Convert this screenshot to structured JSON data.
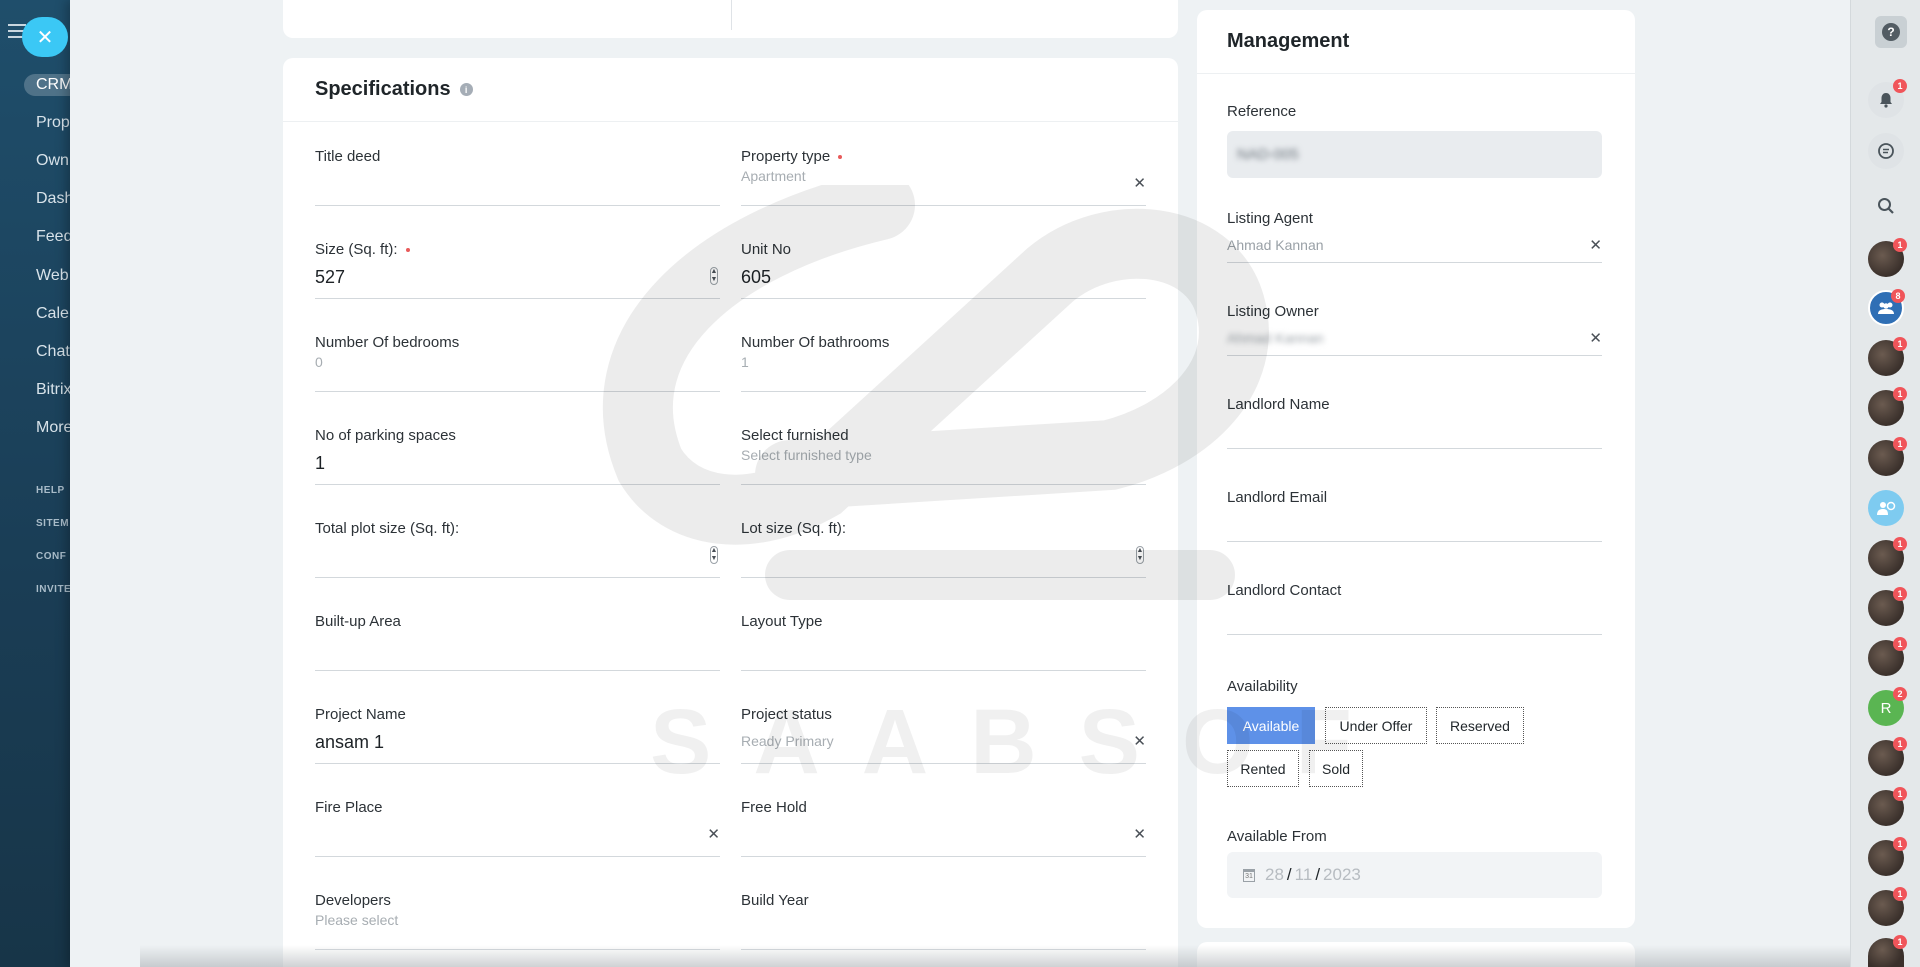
{
  "nav": {
    "items": [
      "CRM",
      "Prop",
      "Own",
      "Dash",
      "Feed",
      "Web",
      "Cale",
      "Chat",
      "Bitrix",
      "More"
    ],
    "small_items": [
      "HELP",
      "SITEM",
      "CONF",
      "INVITE"
    ]
  },
  "specifications": {
    "title": "Specifications",
    "fields": {
      "title_deed": {
        "label": "Title deed",
        "value": ""
      },
      "property_type": {
        "label": "Property type",
        "value": "Apartment"
      },
      "size": {
        "label": "Size (Sq. ft):",
        "value": "527"
      },
      "unit_no": {
        "label": "Unit No",
        "value": "605"
      },
      "bedrooms": {
        "label": "Number Of bedrooms",
        "value": "0"
      },
      "bathrooms": {
        "label": "Number Of bathrooms",
        "value": "1"
      },
      "parking": {
        "label": "No of parking spaces",
        "value": "1"
      },
      "furnished": {
        "label": "Select furnished",
        "placeholder": "Select furnished type"
      },
      "plot_size": {
        "label": "Total plot size (Sq. ft):",
        "value": ""
      },
      "lot_size": {
        "label": "Lot size (Sq. ft):",
        "value": ""
      },
      "built_up": {
        "label": "Built-up Area",
        "value": ""
      },
      "layout_type": {
        "label": "Layout Type",
        "value": ""
      },
      "project_name": {
        "label": "Project Name",
        "value": "ansam 1"
      },
      "project_status": {
        "label": "Project status",
        "value": "Ready Primary"
      },
      "fire_place": {
        "label": "Fire Place",
        "value": ""
      },
      "free_hold": {
        "label": "Free Hold",
        "value": ""
      },
      "developers": {
        "label": "Developers",
        "placeholder": "Please select"
      },
      "build_year": {
        "label": "Build Year",
        "value": ""
      }
    }
  },
  "management": {
    "title": "Management",
    "reference": {
      "label": "Reference",
      "value": "NAD-005"
    },
    "listing_agent": {
      "label": "Listing Agent",
      "value": "Ahmad Kannan"
    },
    "listing_owner": {
      "label": "Listing Owner",
      "value": "Ahmad Kannan"
    },
    "landlord_name": {
      "label": "Landlord Name"
    },
    "landlord_email": {
      "label": "Landlord Email"
    },
    "landlord_contact": {
      "label": "Landlord Contact"
    },
    "availability": {
      "label": "Availability",
      "options": [
        "Available",
        "Under Offer",
        "Reserved",
        "Rented",
        "Sold"
      ],
      "selected": "Available"
    },
    "available_from": {
      "label": "Available From",
      "day": "28",
      "month": "11",
      "year": "2023"
    }
  },
  "watermark": {
    "text": "SAABSOF"
  },
  "right_bar": {
    "notification_badge": "1",
    "group_badge": "8",
    "avatar_badges": [
      "1",
      "1",
      "1",
      "1",
      "1",
      "1",
      "1",
      "2",
      "1",
      "1",
      "1",
      "1",
      "1"
    ],
    "initial_avatar": "R",
    "accent_green": "#5ab552",
    "accent_blue": "#2f6fb5"
  },
  "colors": {
    "primary": "#5e91e8",
    "close_button": "#3bc8f5",
    "required_dot": "#e85a5a"
  }
}
